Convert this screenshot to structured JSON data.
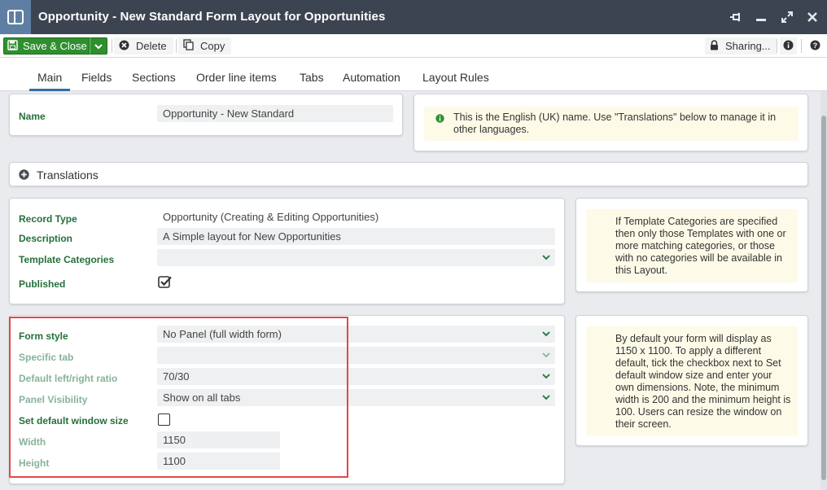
{
  "window": {
    "title": "Opportunity - New Standard Form Layout for Opportunities",
    "controls": [
      "pin-icon",
      "minimize-icon",
      "maximize-icon",
      "close-icon"
    ]
  },
  "toolbar": {
    "save_close_label": "Save & Close",
    "delete_label": "Delete",
    "copy_label": "Copy",
    "sharing_label": "Sharing..."
  },
  "tabs": [
    {
      "label": "Main",
      "active": true
    },
    {
      "label": "Fields",
      "active": false
    },
    {
      "label": "Sections",
      "active": false
    },
    {
      "label": "Order line items",
      "active": false
    },
    {
      "label": "Tabs",
      "active": false
    },
    {
      "label": "Automation",
      "active": false
    },
    {
      "label": "Layout Rules",
      "active": false
    }
  ],
  "name_card": {
    "label": "Name",
    "value": "Opportunity - New Standard",
    "info": "This is the English (UK) name. Use \"Translations\" below to manage it in other languages."
  },
  "translations": {
    "label": "Translations"
  },
  "record_card": {
    "record_type_label": "Record Type",
    "record_type_value": "Opportunity (Creating & Editing Opportunities)",
    "description_label": "Description",
    "description_value": "A Simple layout for New Opportunities",
    "template_categories_label": "Template Categories",
    "template_categories_value": "",
    "published_label": "Published",
    "published_checked": true,
    "info": "If Template Categories are specified then only those Templates with one or more matching categories, or those with no categories will be available in this Layout."
  },
  "form_card": {
    "form_style_label": "Form style",
    "form_style_value": "No Panel (full width form)",
    "specific_tab_label": "Specific tab",
    "specific_tab_value": "",
    "ratio_label": "Default left/right ratio",
    "ratio_value": "70/30",
    "panel_visibility_label": "Panel Visibility",
    "panel_visibility_value": "Show on all tabs",
    "set_default_size_label": "Set default window size",
    "set_default_size_checked": false,
    "width_label": "Width",
    "width_value": "1150",
    "height_label": "Height",
    "height_value": "1100",
    "info": "By default your form will display as 1150 x 1100. To apply a different default, tick the checkbox next to Set default window size and enter your own dimensions. Note, the minimum width is 200 and the minimum height is 100. Users can resize the window on their screen."
  },
  "colors": {
    "titlebar": "#3d4451",
    "accent_blue": "#2e6ea6",
    "save_green": "#2f8f2f",
    "label_green": "#24703b",
    "highlight_red": "#e04848"
  }
}
